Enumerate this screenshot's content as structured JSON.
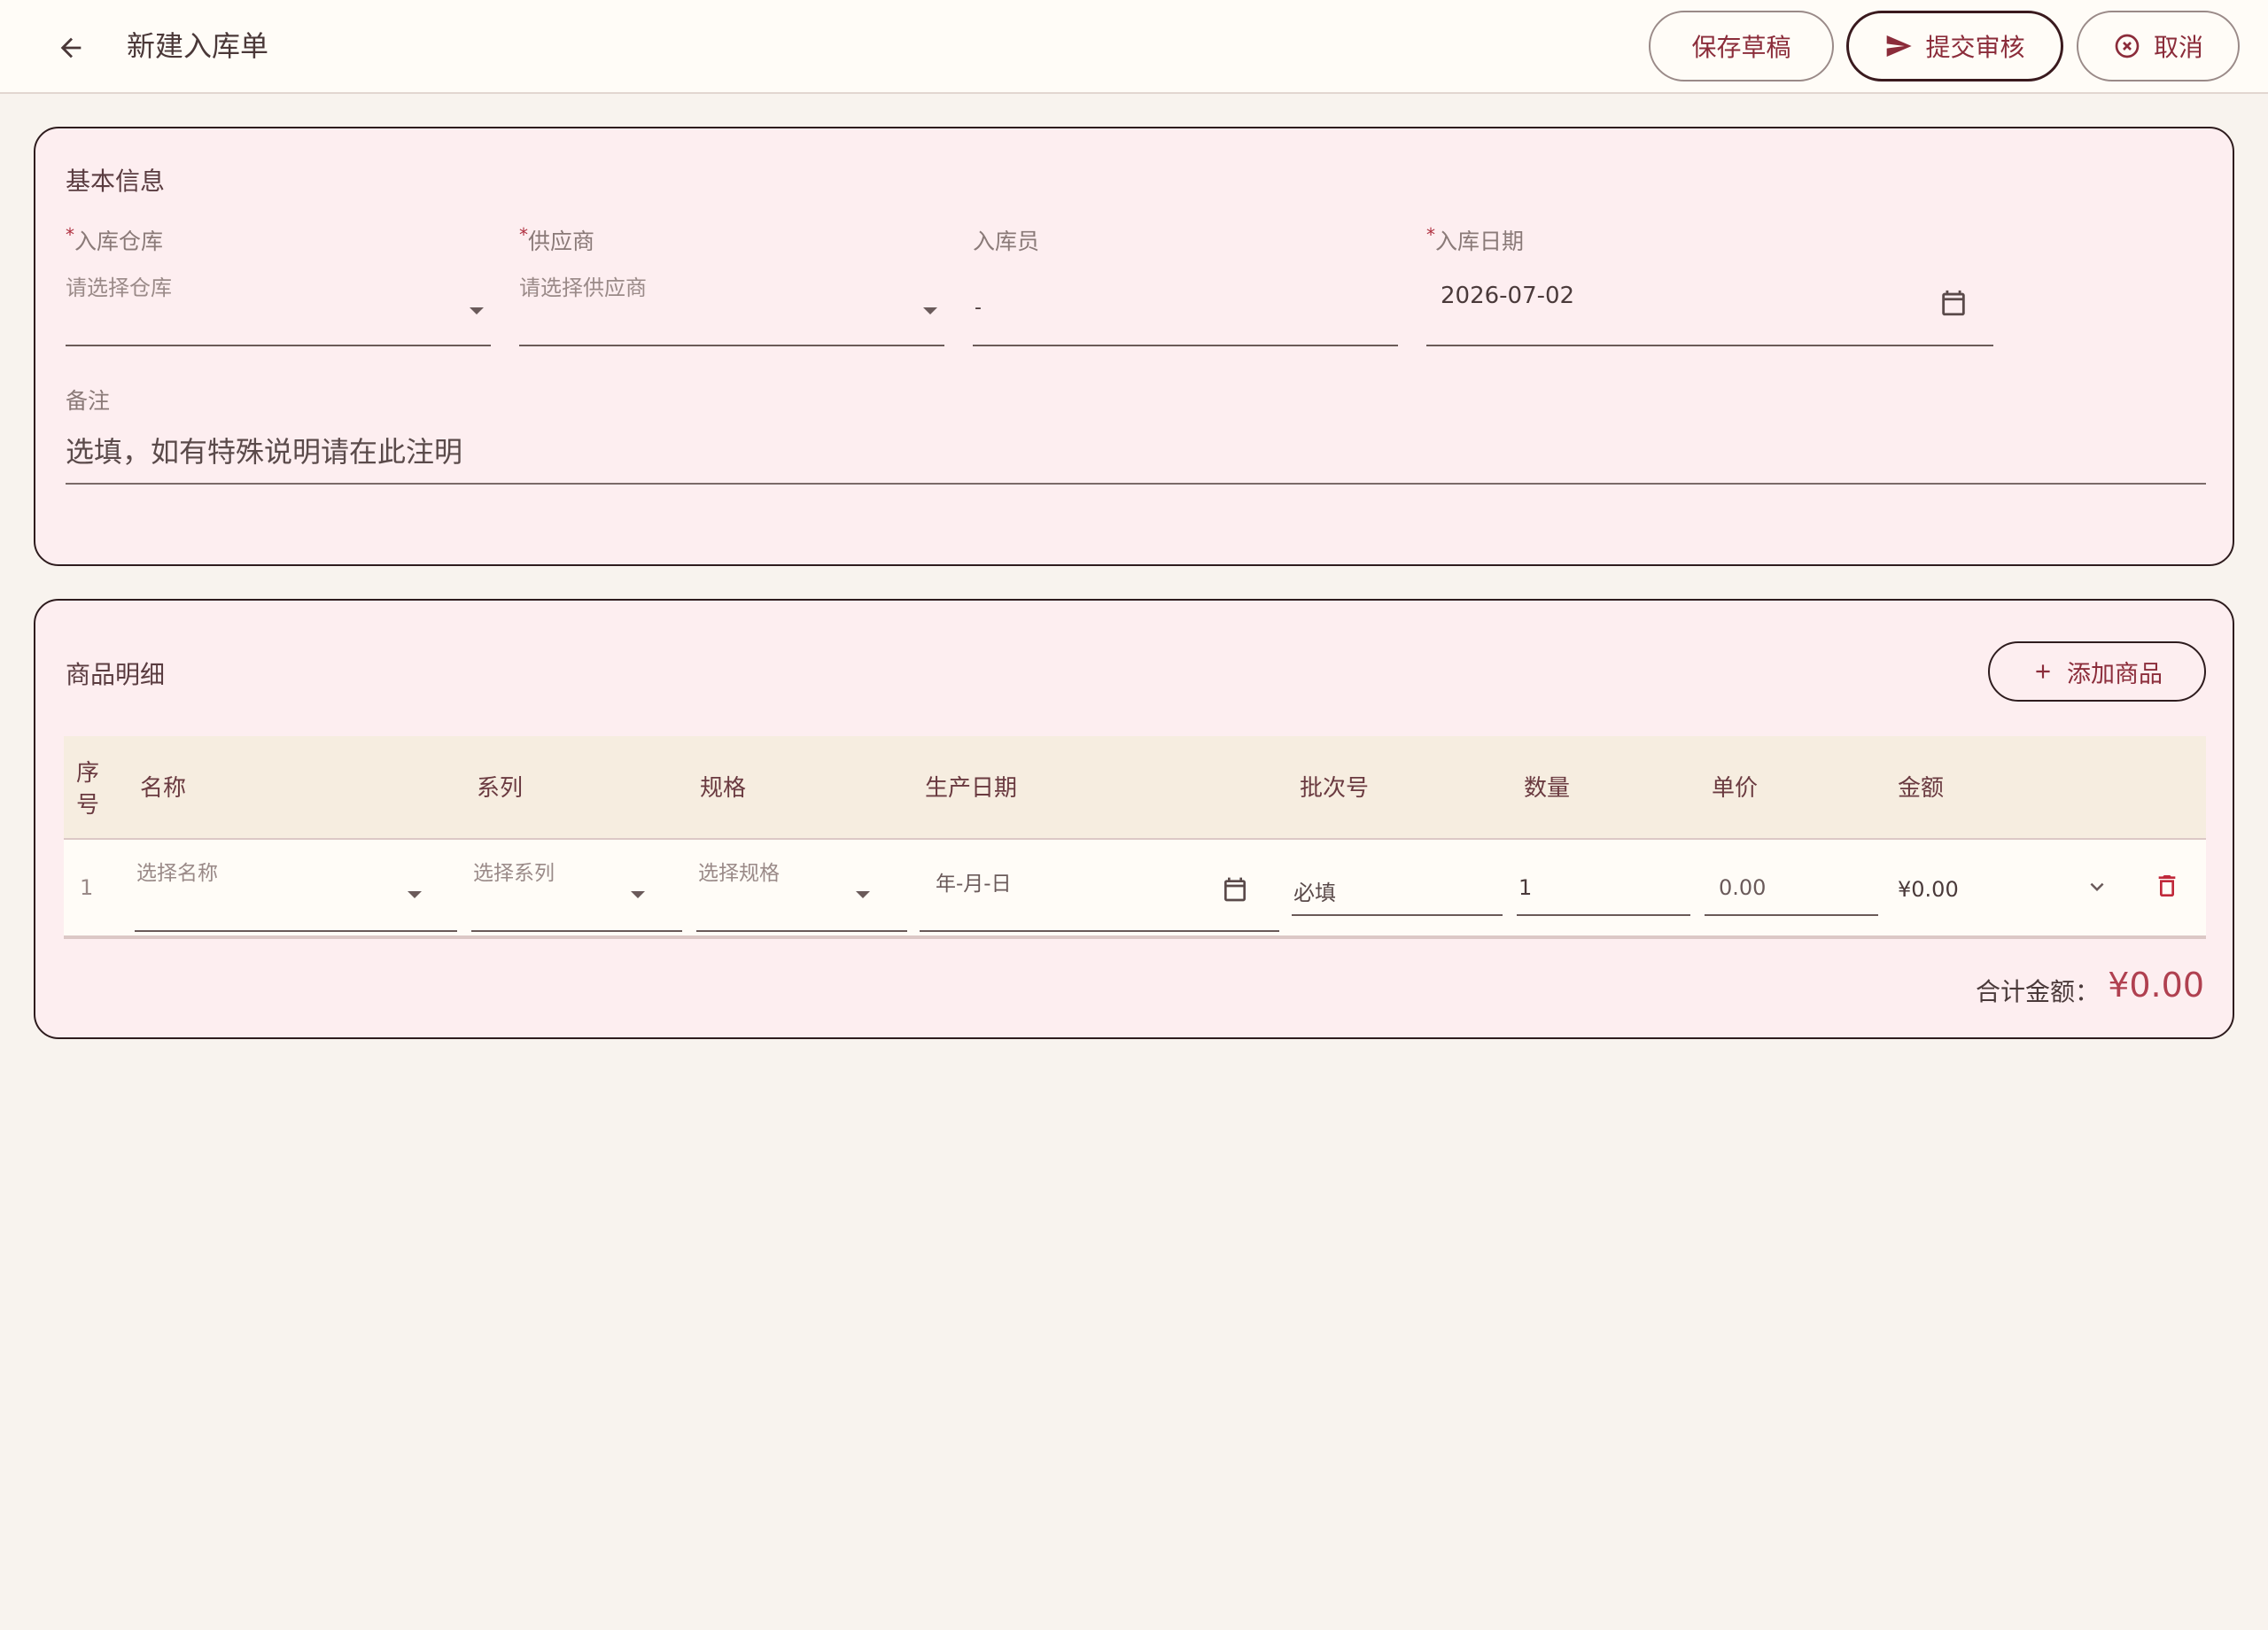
{
  "header": {
    "title": "新建入库单",
    "buttons": {
      "save": "保存草稿",
      "submit": "提交审核",
      "cancel": "取消"
    }
  },
  "basic_info": {
    "title": "基本信息",
    "warehouse": {
      "label": "入库仓库",
      "required": "*",
      "placeholder": "请选择仓库"
    },
    "supplier": {
      "label": "供应商",
      "required": "*",
      "placeholder": "请选择供应商"
    },
    "operator": {
      "label": "入库员",
      "value": "-"
    },
    "date": {
      "label": "入库日期",
      "required": "*",
      "value": "2026-07-02"
    },
    "remark": {
      "label": "备注",
      "placeholder": "选填，如有特殊说明请在此注明"
    }
  },
  "items": {
    "title": "商品明细",
    "add_button": "添加商品",
    "columns": {
      "seq": "序号",
      "name": "名称",
      "series": "系列",
      "spec": "规格",
      "prod_date": "生产日期",
      "batch": "批次号",
      "qty": "数量",
      "price": "单价",
      "amount": "金额"
    },
    "rows": [
      {
        "seq": "1",
        "name_placeholder": "选择名称",
        "series_placeholder": "选择系列",
        "spec_placeholder": "选择规格",
        "date_placeholder": "年-月-日",
        "batch_placeholder": "必填",
        "qty": "1",
        "price_placeholder": "0.00",
        "amount": "¥0.00"
      }
    ],
    "total_label": "合计金额：",
    "total_value": "¥0.00"
  },
  "colors": {
    "accent": "#8b2c3a",
    "card_bg": "#fdeef0",
    "header_bg": "#f6ede0",
    "total": "#b04050"
  }
}
